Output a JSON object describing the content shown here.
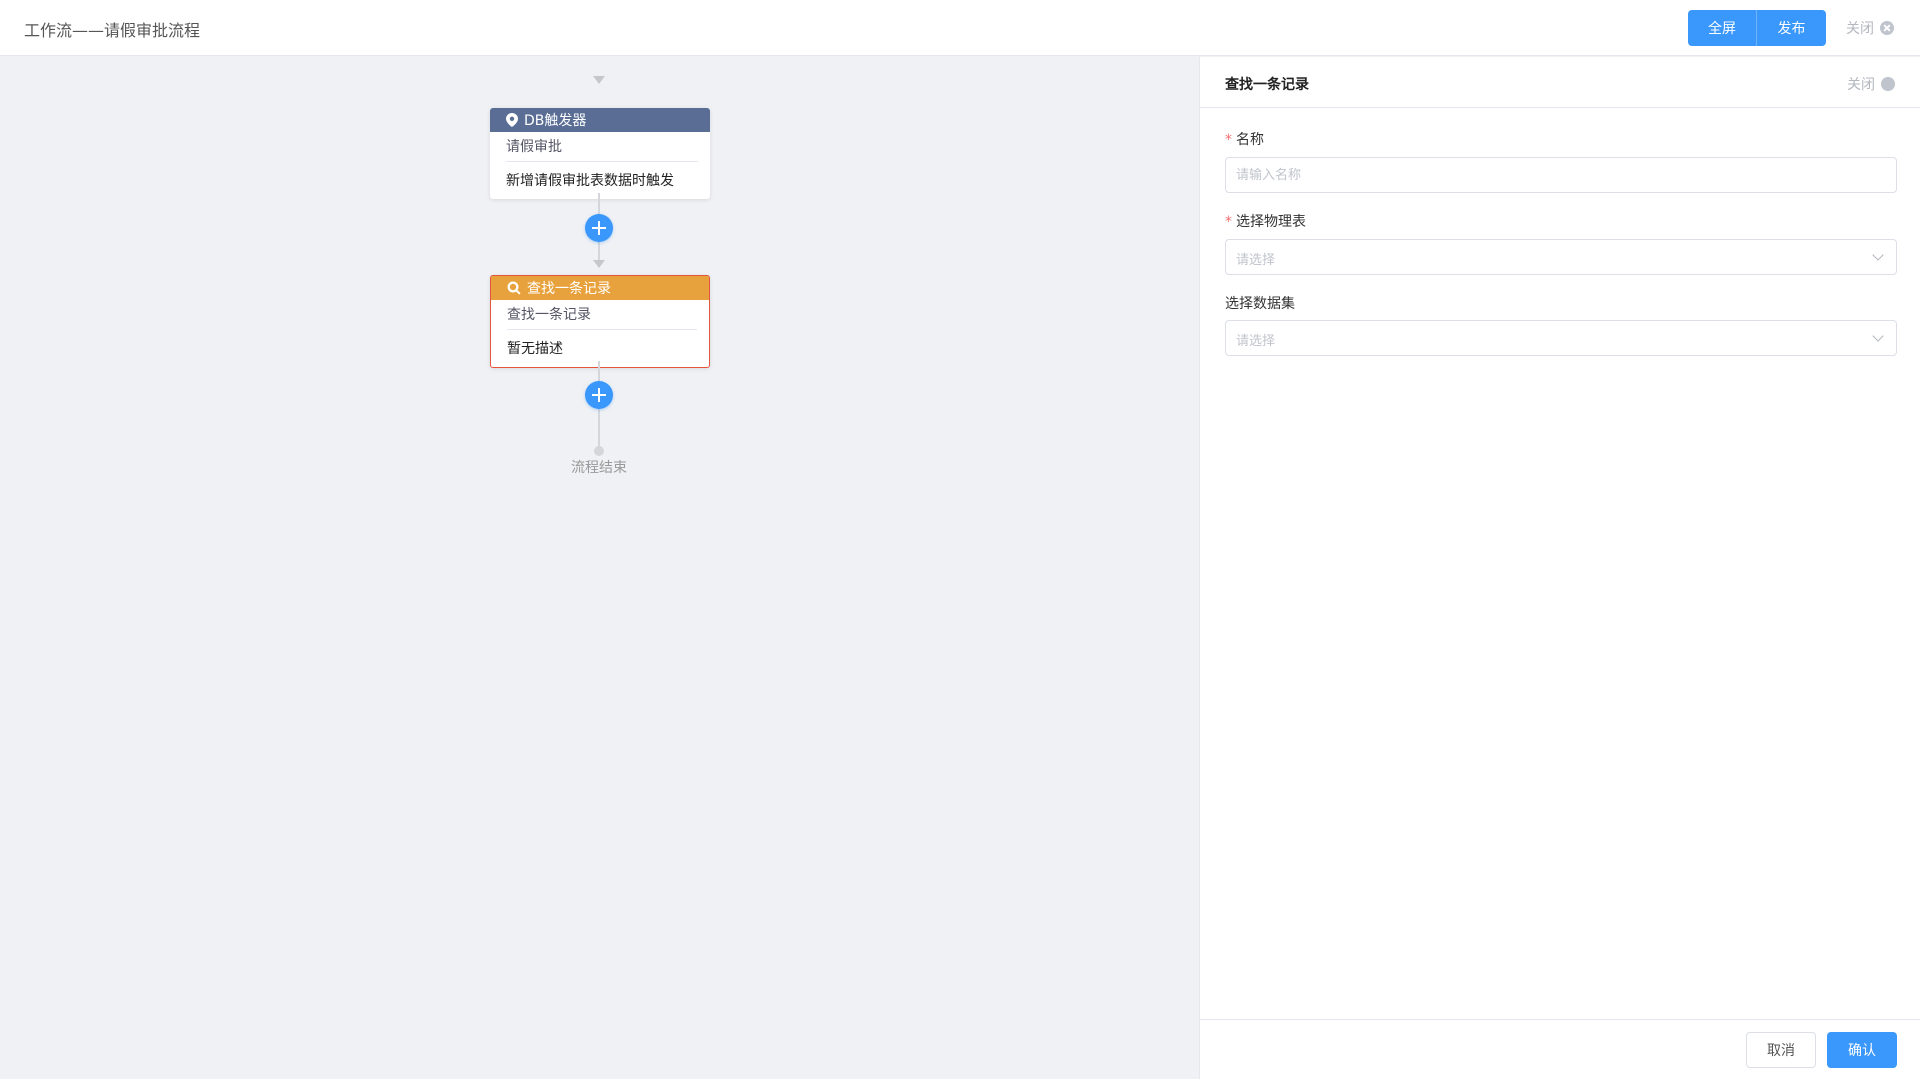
{
  "header": {
    "title": "工作流——请假审批流程",
    "fullscreen_label": "全屏",
    "publish_label": "发布",
    "close_label": "关闭"
  },
  "flow": {
    "trigger_node": {
      "type_label": "DB触发器",
      "icon": "location-pin-icon",
      "name": "请假审批",
      "description": "新增请假审批表数据时触发"
    },
    "query_node": {
      "type_label": "查找一条记录",
      "icon": "search-icon",
      "name": "查找一条记录",
      "description": "暂无描述"
    },
    "end_label": "流程结束"
  },
  "panel": {
    "title": "查找一条记录",
    "close_label": "关闭",
    "fields": {
      "name_label": "名称",
      "name_placeholder": "请输入名称",
      "name_value": "",
      "table_label": "选择物理表",
      "table_placeholder": "请选择",
      "dataset_label": "选择数据集",
      "dataset_placeholder": "请选择"
    },
    "cancel_label": "取消",
    "confirm_label": "确认"
  },
  "colors": {
    "primary": "#3a97fb",
    "trigger_header": "#5a6e95",
    "query_header": "#e8a23d",
    "query_border": "#e4543a",
    "required_mark": "#f56c6c"
  }
}
